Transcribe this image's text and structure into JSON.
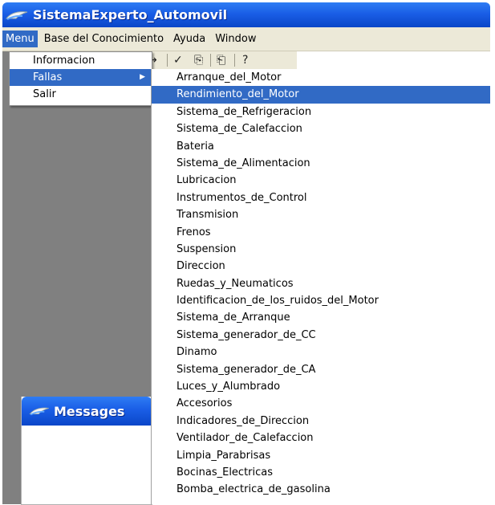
{
  "window": {
    "title": "SistemaExperto_Automovil"
  },
  "menubar": {
    "items": [
      {
        "label": "Menu"
      },
      {
        "label": "Base del Conocimiento"
      },
      {
        "label": "Ayuda"
      },
      {
        "label": "Window"
      }
    ]
  },
  "menu": {
    "items": [
      {
        "label": "Informacion"
      },
      {
        "label": "Fallas"
      },
      {
        "label": "Salir"
      }
    ]
  },
  "fallas_submenu": {
    "items": [
      "Arranque_del_Motor",
      "Rendimiento_del_Motor",
      "Sistema_de_Refrigeracion",
      "Sistema_de_Calefaccion",
      "Bateria",
      "Sistema_de_Alimentacion",
      "Lubricacion",
      "Instrumentos_de_Control",
      "Transmision",
      "Frenos",
      "Suspension",
      "Direccion",
      "Ruedas_y_Neumaticos",
      "Identificacion_de_los_ruidos_del_Motor",
      "Sistema_de_Arranque",
      "Sistema_generador_de_CC",
      "Dinamo",
      "Sistema_generador_de_CA",
      "Luces_y_Alumbrado",
      "Accesorios",
      "Indicadores_de_Direccion",
      "Ventilador_de_Calefaccion",
      "Limpia_Parabrisas",
      "Bocinas_Electricas",
      "Bomba_electrica_de_gasolina"
    ],
    "highlighted": "Rendimiento_del_Motor"
  },
  "messages_panel": {
    "title": "Messages"
  },
  "toolbar": {
    "icons": [
      "redo-arrow-icon",
      "check-icon",
      "copy-icon",
      "paste-icon",
      "help-icon"
    ],
    "glyphs": [
      "↦",
      "✓",
      "⎘",
      "⎗",
      "?"
    ]
  },
  "colors": {
    "title_blue": "#1a5ee6",
    "highlight_blue": "#316ac5",
    "menubar_bg": "#ece9d8",
    "workarea_gray": "#808080"
  }
}
